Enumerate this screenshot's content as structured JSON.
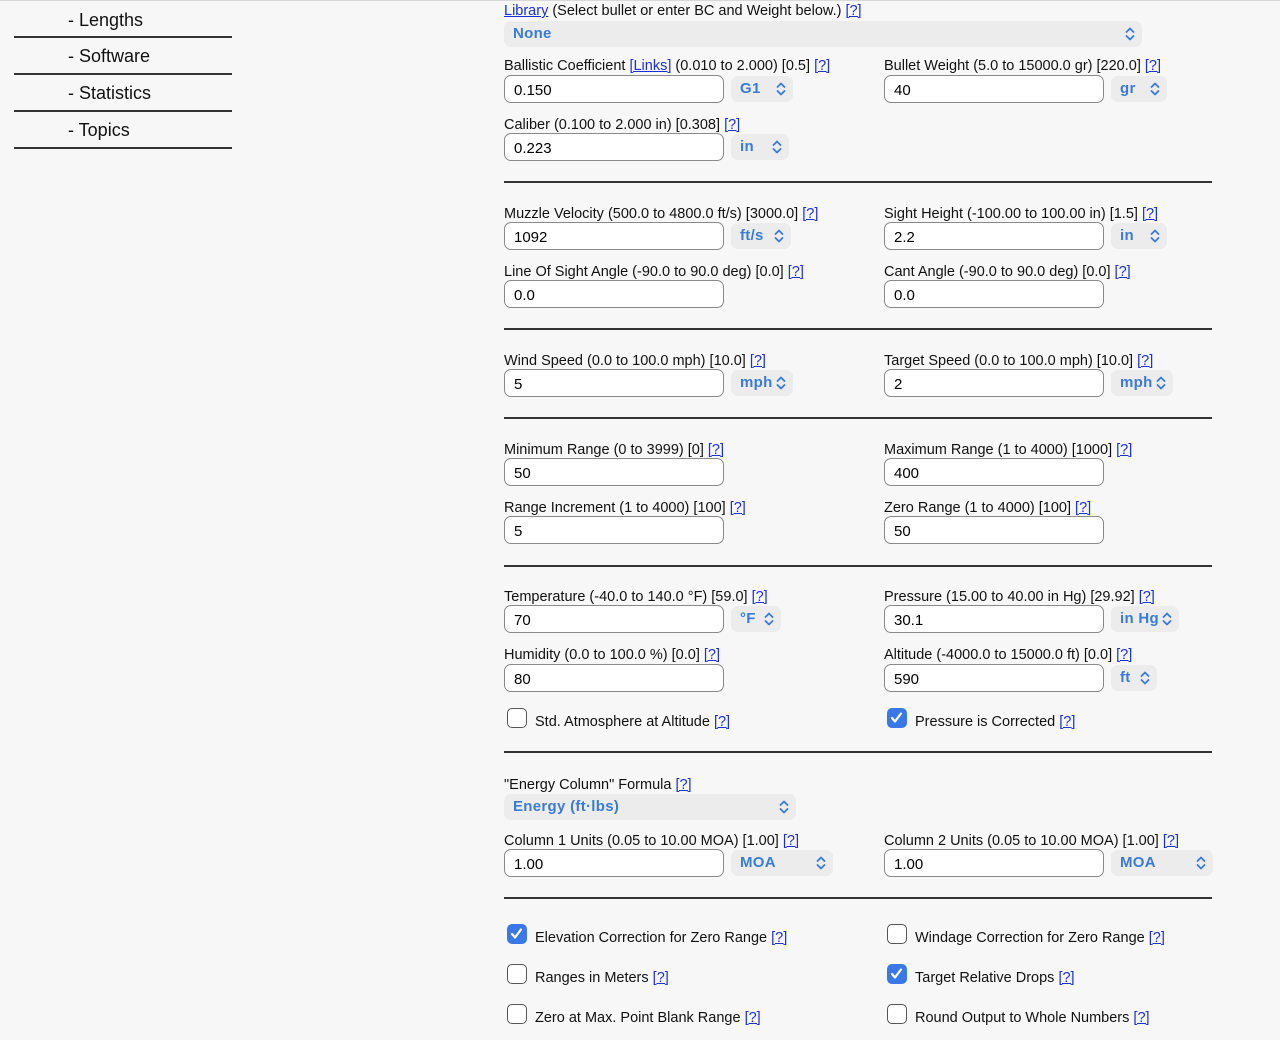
{
  "sidebar": {
    "items": [
      {
        "label": "- Lengths"
      },
      {
        "label": "- Software"
      },
      {
        "label": "- Statistics"
      },
      {
        "label": "- Topics"
      }
    ]
  },
  "help": "[?]",
  "library": {
    "link": "Library",
    "text": " (Select bullet or enter BC and Weight below.) ",
    "value": "None"
  },
  "bc": {
    "label": "Ballistic Coefficient ",
    "links": "[Links]",
    "range": " (0.010 to 2.000) [0.5] ",
    "value": "0.150",
    "unit": "G1"
  },
  "bullet_weight": {
    "label": "Bullet Weight (5.0 to 15000.0 gr) [220.0] ",
    "value": "40",
    "unit": "gr"
  },
  "caliber": {
    "label": "Caliber (0.100 to 2.000 in) [0.308] ",
    "value": "0.223",
    "unit": "in"
  },
  "muzzle_velocity": {
    "label": "Muzzle Velocity (500.0 to 4800.0 ft/s) [3000.0] ",
    "value": "1092",
    "unit": "ft/s"
  },
  "sight_height": {
    "label": "Sight Height (-100.00 to 100.00 in) [1.5] ",
    "value": "2.2",
    "unit": "in"
  },
  "los_angle": {
    "label": "Line Of Sight Angle (-90.0 to 90.0 deg) [0.0] ",
    "value": "0.0"
  },
  "cant_angle": {
    "label": "Cant Angle (-90.0 to 90.0 deg) [0.0] ",
    "value": "0.0"
  },
  "wind_speed": {
    "label": "Wind Speed (0.0 to 100.0 mph) [10.0] ",
    "value": "5",
    "unit": "mph"
  },
  "target_speed": {
    "label": "Target Speed (0.0 to 100.0 mph) [10.0] ",
    "value": "2",
    "unit": "mph"
  },
  "min_range": {
    "label": "Minimum Range (0 to 3999) [0] ",
    "value": "50"
  },
  "max_range": {
    "label": "Maximum Range (1 to 4000) [1000] ",
    "value": "400"
  },
  "range_increment": {
    "label": "Range Increment (1 to 4000) [100] ",
    "value": "5"
  },
  "zero_range": {
    "label": "Zero Range (1 to 4000) [100] ",
    "value": "50"
  },
  "temperature": {
    "label": "Temperature (-40.0 to 140.0 °F) [59.0] ",
    "value": "70",
    "unit": "°F"
  },
  "pressure": {
    "label": "Pressure (15.00 to 40.00 in Hg) [29.92] ",
    "value": "30.1",
    "unit": "in Hg"
  },
  "humidity": {
    "label": "Humidity (0.0 to 100.0 %) [0.0] ",
    "value": "80"
  },
  "altitude": {
    "label": "Altitude (-4000.0 to 15000.0 ft) [0.0] ",
    "value": "590",
    "unit": "ft"
  },
  "std_atmosphere": {
    "label": "Std. Atmosphere at Altitude ",
    "checked": false
  },
  "pressure_corrected": {
    "label": "Pressure is Corrected ",
    "checked": true
  },
  "energy_formula": {
    "label": "\"Energy Column\" Formula ",
    "value": "Energy (ft·lbs)"
  },
  "col1_units": {
    "label": "Column 1 Units (0.05 to 10.00 MOA) [1.00] ",
    "value": "1.00",
    "unit": "MOA"
  },
  "col2_units": {
    "label": "Column 2 Units (0.05 to 10.00 MOA) [1.00] ",
    "value": "1.00",
    "unit": "MOA"
  },
  "options": {
    "elevation_correction": {
      "label": "Elevation Correction for Zero Range ",
      "checked": true
    },
    "windage_correction": {
      "label": "Windage Correction for Zero Range ",
      "checked": false
    },
    "ranges_in_meters": {
      "label": "Ranges in Meters ",
      "checked": false
    },
    "target_relative_drops": {
      "label": "Target Relative Drops ",
      "checked": true
    },
    "zero_max_pbr": {
      "label": "Zero at Max. Point Blank Range ",
      "checked": false
    },
    "round_output": {
      "label": "Round Output to Whole Numbers ",
      "checked": false
    }
  },
  "colors": {
    "accent": "#3b78e7",
    "link": "#1a2fd6",
    "select_text": "#3a7bd5"
  }
}
